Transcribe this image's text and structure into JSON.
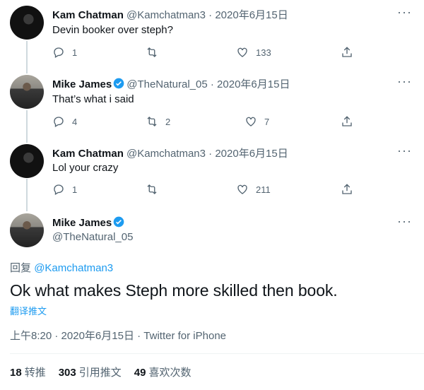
{
  "tweets": [
    {
      "name": "Kam Chatman",
      "handle": "@Kamchatman3",
      "date": "2020年6月15日",
      "text": "Devin booker over steph?",
      "replies": "1",
      "retweets": "",
      "likes": "133",
      "verified": false
    },
    {
      "name": "Mike James",
      "handle": "@TheNatural_05",
      "date": "2020年6月15日",
      "text": "That’s what i said",
      "replies": "4",
      "retweets": "2",
      "likes": "7",
      "verified": true
    },
    {
      "name": "Kam Chatman",
      "handle": "@Kamchatman3",
      "date": "2020年6月15日",
      "text": "Lol your crazy",
      "replies": "1",
      "retweets": "",
      "likes": "211",
      "verified": false
    }
  ],
  "main": {
    "name": "Mike James",
    "handle": "@TheNatural_05",
    "reply_prefix": "回复",
    "reply_mention": "@Kamchatman3",
    "text": "Ok what makes Steph more skilled then book.",
    "translate": "翻译推文",
    "time": "上午8:20",
    "date": "2020年6月15日",
    "source": "Twitter for iPhone",
    "sep": " · ",
    "stats": {
      "retweets_count": "18",
      "retweets_label": "转推",
      "quotes_count": "303",
      "quotes_label": "引用推文",
      "likes_count": "49",
      "likes_label": "喜欢次数"
    }
  },
  "dot_sep": " · ",
  "icons": {
    "reply": "reply-icon",
    "retweet": "retweet-icon",
    "like": "heart-icon",
    "share": "share-icon",
    "more": "more-icon",
    "verified": "verified-badge-icon"
  },
  "colors": {
    "accent": "#1d9bf0",
    "muted": "#536471",
    "text": "#0f1419"
  }
}
